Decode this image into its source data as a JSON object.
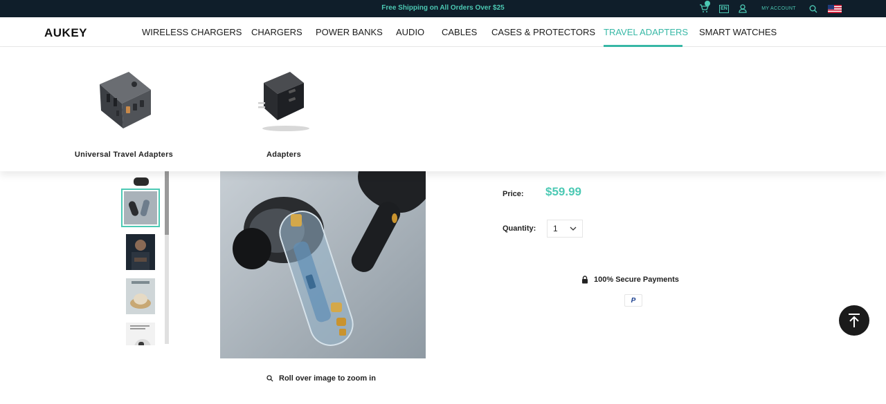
{
  "topbar": {
    "promo": "Free Shipping on All Orders Over $25",
    "lang": "EN",
    "my_account": "MY ACCOUNT"
  },
  "nav": {
    "logo": "AUKEY",
    "items": [
      {
        "label": "WIRELESS CHARGERS"
      },
      {
        "label": "CHARGERS"
      },
      {
        "label": "POWER BANKS"
      },
      {
        "label": "AUDIO"
      },
      {
        "label": "CABLES"
      },
      {
        "label": "CASES & PROTECTORS"
      },
      {
        "label": "TRAVEL ADAPTERS"
      },
      {
        "label": "SMART WATCHES"
      }
    ],
    "active": "TRAVEL ADAPTERS"
  },
  "mega_menu": {
    "items": [
      {
        "label": "Universal Travel Adapters"
      },
      {
        "label": "Adapters"
      }
    ]
  },
  "gallery": {
    "zoom_hint": "Roll over image to zoom in"
  },
  "product": {
    "price_label": "Price:",
    "price": "$59.99",
    "quantity_label": "Quantity:",
    "quantity": "1",
    "secure_text": "100% Secure Payments",
    "paypal": "P"
  },
  "colors": {
    "accent": "#4cc9b4",
    "topbar_bg": "#0f1e2a"
  }
}
